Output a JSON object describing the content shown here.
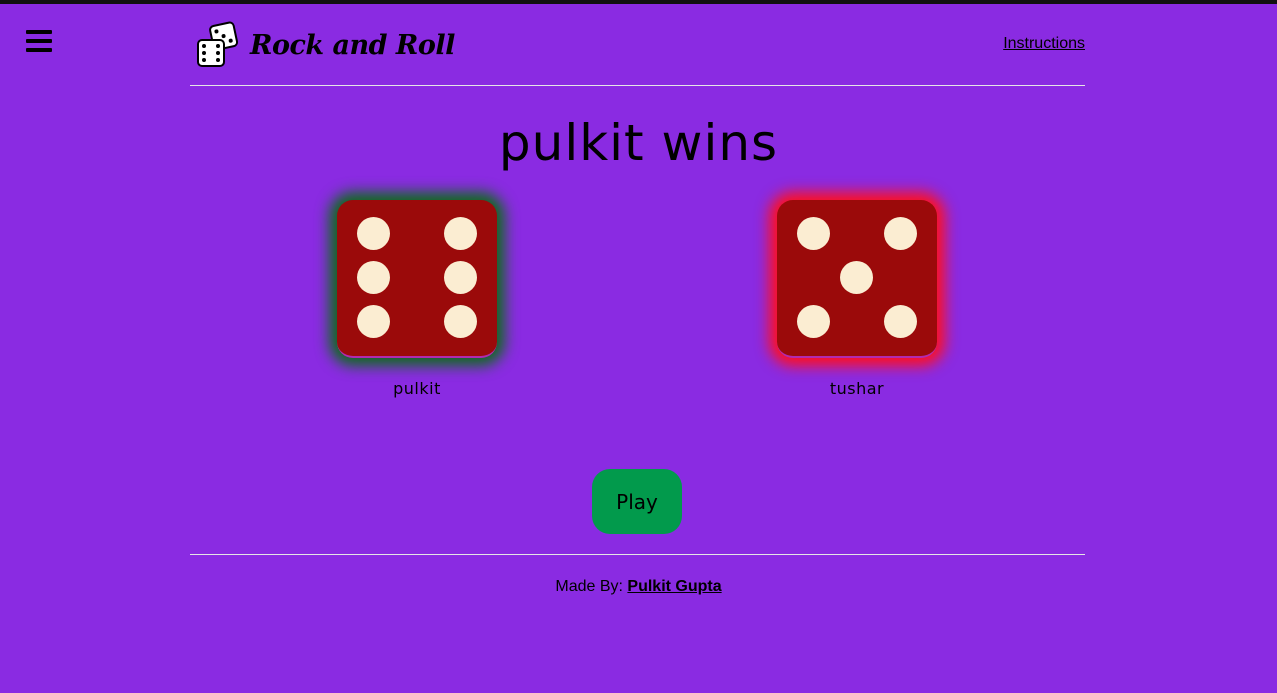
{
  "header": {
    "brand": "Rock and Roll",
    "logo_icon": "dice-icon",
    "instructions_link": "Instructions",
    "menu_icon": "hamburger-menu-icon"
  },
  "game": {
    "result_title": "pulkit wins",
    "players": [
      {
        "name": "pulkit",
        "die_value": 6,
        "status": "winner",
        "glow_color": "#0f6b1d"
      },
      {
        "name": "tushar",
        "die_value": 5,
        "status": "loser",
        "glow_color": "#ff1020"
      }
    ],
    "play_button": "Play"
  },
  "footer": {
    "made_by_label": "Made By:",
    "author": "Pulkit Gupta"
  },
  "colors": {
    "background": "#8a2be2",
    "die_face": "#9b0a0a",
    "pip": "#fbedd2",
    "play_button": "#029a4c"
  }
}
